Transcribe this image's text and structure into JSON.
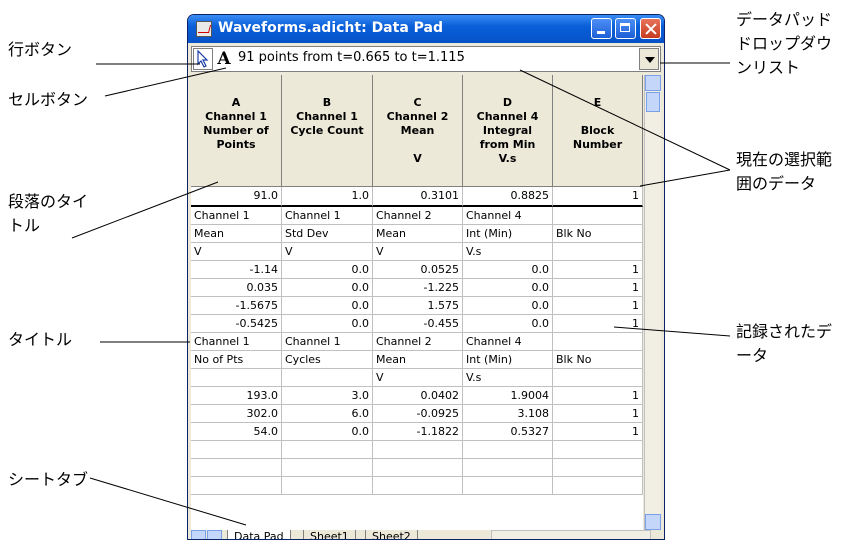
{
  "window": {
    "title": "Waveforms.adicht: Data Pad",
    "toolbar_A": "A",
    "range_text": "91 points from t=0.665 to t=1.115"
  },
  "columns": [
    {
      "letter": "A",
      "line1": "Channel 1",
      "line2": "Number of",
      "line3": "Points",
      "unit": ""
    },
    {
      "letter": "B",
      "line1": "Channel 1",
      "line2": "Cycle Count",
      "line3": "",
      "unit": ""
    },
    {
      "letter": "C",
      "line1": "Channel 2",
      "line2": "Mean",
      "line3": "",
      "unit": "V"
    },
    {
      "letter": "D",
      "line1": "Channel 4",
      "line2": "Integral",
      "line3": "from Min",
      "unit": "V.s"
    },
    {
      "letter": "E",
      "line1": "",
      "line2": "Block",
      "line3": "Number",
      "unit": ""
    }
  ],
  "summary_row": [
    "91.0",
    "1.0",
    "0.3101",
    "0.8825",
    "1"
  ],
  "rows": [
    [
      "Channel 1",
      "Channel 1",
      "Channel 2",
      "Channel 4",
      ""
    ],
    [
      "Mean",
      "Std Dev",
      "Mean",
      "Int (Min)",
      "Blk No"
    ],
    [
      "V",
      "V",
      "V",
      "V.s",
      ""
    ],
    [
      "-1.14",
      "0.0",
      "0.0525",
      "0.0",
      "1"
    ],
    [
      "0.035",
      "0.0",
      "-1.225",
      "0.0",
      "1"
    ],
    [
      "-1.5675",
      "0.0",
      "1.575",
      "0.0",
      "1"
    ],
    [
      "-0.5425",
      "0.0",
      "-0.455",
      "0.0",
      "1"
    ],
    [
      "Channel 1",
      "Channel 1",
      "Channel 2",
      "Channel 4",
      ""
    ],
    [
      "No of Pts",
      "Cycles",
      "Mean",
      "Int (Min)",
      "Blk No"
    ],
    [
      "",
      "",
      "V",
      "V.s",
      ""
    ],
    [
      "193.0",
      "3.0",
      "0.0402",
      "1.9004",
      "1"
    ],
    [
      "302.0",
      "6.0",
      "-0.0925",
      "3.108",
      "1"
    ],
    [
      "54.0",
      "0.0",
      "-1.1822",
      "0.5327",
      "1"
    ],
    [
      "",
      "",
      "",
      "",
      ""
    ],
    [
      "",
      "",
      "",
      "",
      ""
    ],
    [
      "",
      "",
      "",
      "",
      ""
    ]
  ],
  "tabs": [
    "Data Pad",
    "Sheet1",
    "Sheet2"
  ],
  "annotations": {
    "row_button": "行ボタン",
    "cell_button": "セルボタン",
    "paragraph_title": "段落のタイトル",
    "title": "タイトル",
    "sheet_tab": "シートタブ",
    "dropdown": "データパッドドロップダウンリスト",
    "current_selection": "現在の選択範囲のデータ",
    "recorded_data": "記録されたデータ"
  }
}
